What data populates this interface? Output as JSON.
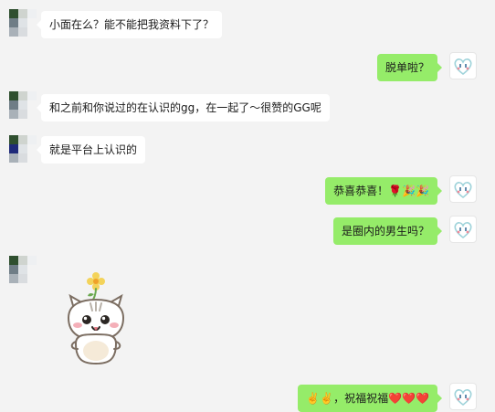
{
  "messages": [
    {
      "side": "left",
      "text": "小面在么？能不能把我资料下了？"
    },
    {
      "side": "right",
      "text": "脱单啦？"
    },
    {
      "side": "left",
      "text": "和之前和你说过的在认识的gg，在一起了～很赞的GG呢"
    },
    {
      "side": "left",
      "text": "就是平台上认识的"
    },
    {
      "side": "right",
      "text": "恭喜恭喜！🌹🎉🎉"
    },
    {
      "side": "right",
      "text": "是圈内的男生吗？"
    },
    {
      "side": "left",
      "sticker": "cat-sticker-with-flower"
    },
    {
      "side": "right",
      "text": "✌️✌️，祝福祝福❤️❤️❤️"
    }
  ],
  "colors": {
    "background": "#f3f3f3",
    "bubble_left": "#ffffff",
    "bubble_right": "#95ec69",
    "avatar_left_tiles": [
      "#2f4f2f",
      "#cfd4cf",
      "#e6e9e6",
      "#6f7d86",
      "#1f2a7a",
      "#dfe3e6",
      "#a9b1b8",
      "#d9dcdf",
      "#eef0f2"
    ]
  },
  "icons": {
    "right_avatar": "heart-face-avatar-icon",
    "left_avatar": "pixelated-avatar-icon"
  }
}
